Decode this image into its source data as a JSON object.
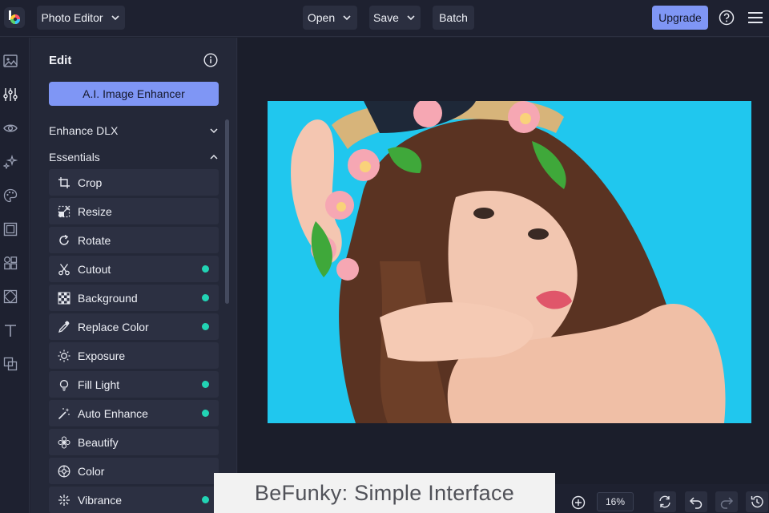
{
  "topbar": {
    "app_menu_label": "Photo Editor",
    "open_label": "Open",
    "save_label": "Save",
    "batch_label": "Batch",
    "upgrade_label": "Upgrade",
    "help_icon": "question-circle-icon",
    "menu_icon": "hamburger-icon"
  },
  "rail": {
    "items": [
      "image-icon",
      "sliders-icon",
      "eye-icon",
      "sparkle-icon",
      "palette-icon",
      "frame-icon",
      "shapes-icon",
      "texture-icon",
      "text-icon",
      "overlay-icon"
    ]
  },
  "panel": {
    "title": "Edit",
    "enhancer_label": "A.I. Image Enhancer",
    "sections": [
      {
        "label": "Enhance DLX",
        "state": "collapsed"
      },
      {
        "label": "Essentials",
        "state": "expanded"
      }
    ],
    "tools": [
      {
        "label": "Crop",
        "icon": "crop-icon",
        "premium": false
      },
      {
        "label": "Resize",
        "icon": "resize-icon",
        "premium": false
      },
      {
        "label": "Rotate",
        "icon": "rotate-icon",
        "premium": false
      },
      {
        "label": "Cutout",
        "icon": "scissors-icon",
        "premium": true
      },
      {
        "label": "Background",
        "icon": "checkerboard-icon",
        "premium": true
      },
      {
        "label": "Replace Color",
        "icon": "eyedropper-icon",
        "premium": true
      },
      {
        "label": "Exposure",
        "icon": "sun-icon",
        "premium": false
      },
      {
        "label": "Fill Light",
        "icon": "bulb-icon",
        "premium": true
      },
      {
        "label": "Auto Enhance",
        "icon": "magic-wand-icon",
        "premium": true
      },
      {
        "label": "Beautify",
        "icon": "flower-icon",
        "premium": false
      },
      {
        "label": "Color",
        "icon": "color-wheel-icon",
        "premium": false
      },
      {
        "label": "Vibrance",
        "icon": "vibrance-icon",
        "premium": true
      }
    ]
  },
  "canvas": {
    "photo_description_icon": "photo-image"
  },
  "bottombar": {
    "zoom_value": "16%"
  },
  "caption": "BeFunky: Simple Interface",
  "colors": {
    "accent": "#7f96f5",
    "premium_dot": "#22d3b4",
    "photo_bg": "#20c7ee"
  }
}
